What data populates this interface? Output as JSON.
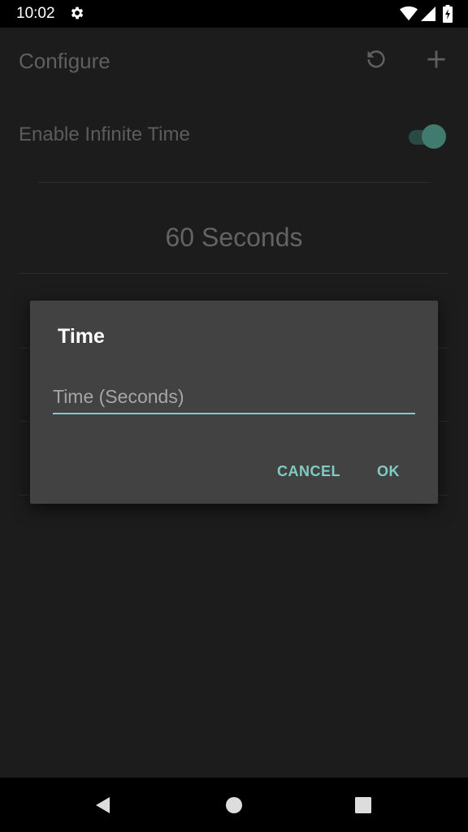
{
  "status_bar": {
    "time": "10:02",
    "icons": [
      "gear-icon",
      "wifi-icon",
      "signal-icon",
      "battery-icon"
    ]
  },
  "app_bar": {
    "title": "Configure",
    "actions": [
      "reset-icon",
      "add-icon"
    ]
  },
  "settings": {
    "infinite_time_label": "Enable Infinite Time",
    "infinite_time_enabled": true,
    "seconds_display": "60 Seconds"
  },
  "dialog": {
    "title": "Time",
    "input_value": "",
    "input_placeholder": "Time (Seconds)",
    "cancel_label": "CANCEL",
    "ok_label": "OK"
  },
  "nav_bar": {
    "icons": [
      "back-icon",
      "home-icon",
      "recents-icon"
    ]
  },
  "colors": {
    "accent": "#80cbc4",
    "dialog_bg": "#424242",
    "scrim_bg": "#1c1c1c"
  }
}
